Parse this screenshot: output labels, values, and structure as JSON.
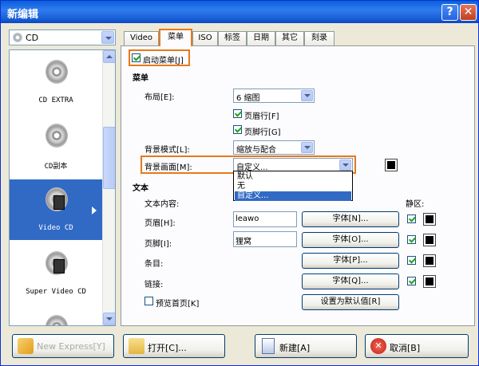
{
  "window": {
    "title": "新编辑",
    "help_label": "?",
    "close_label": "✕"
  },
  "disc_type": {
    "value": "CD"
  },
  "disc_list": [
    {
      "label": "CD EXTRA",
      "icon": "cd-music-icon"
    },
    {
      "label": "CD副本",
      "icon": "cd-copy-icon"
    },
    {
      "label": "Video CD",
      "icon": "video-cd-icon",
      "selected": true
    },
    {
      "label": "Super Video CD",
      "icon": "super-video-cd-icon"
    }
  ],
  "tabs": [
    {
      "label": "Video CD"
    },
    {
      "label": "菜单",
      "active": true
    },
    {
      "label": "ISO"
    },
    {
      "label": "标签"
    },
    {
      "label": "日期"
    },
    {
      "label": "其它"
    },
    {
      "label": "刻录"
    }
  ],
  "menu_tab": {
    "enable_menu": {
      "label": "启动菜单[J]",
      "checked": true
    },
    "menu_section": "菜单",
    "layout_label": "布局[E]:",
    "layout_value": "6 缩图",
    "header_row": {
      "label": "页眉行[F]",
      "checked": true
    },
    "footer_row": {
      "label": "页脚行[G]",
      "checked": true
    },
    "bg_mode_label": "背景模式[L]:",
    "bg_mode_value": "缩放与配合",
    "bg_picture_label": "背景画面[M]:",
    "bg_picture_value": "自定义...",
    "bg_picture_options": [
      "默认",
      "无",
      "自定义..."
    ],
    "bg_picture_selected_index": 2,
    "text_section": "文本",
    "text_content_label": "文本内容:",
    "hotspot_label": "静区:",
    "header_label": "页眉[H]:",
    "header_value": "leawo",
    "footer_label": "页脚[I]:",
    "footer_value": "狸窝",
    "item_label": "条目:",
    "link_label": "链接:",
    "font_n": "字体[N]...",
    "font_o": "字体[O]...",
    "font_p": "字体[P]...",
    "font_q": "字体[Q]...",
    "preview_first": {
      "label": "预览首页[K]",
      "checked": false
    },
    "set_default": "设置为默认值[R]"
  },
  "bottom": {
    "new_express": "New Express[Y]",
    "open": "打开[C]...",
    "new": "新建[A]",
    "cancel": "取消[B]"
  },
  "colors": {
    "accent_orange": "#e8781a",
    "title_blue": "#0a5fd8",
    "selection_blue": "#316ac5"
  }
}
